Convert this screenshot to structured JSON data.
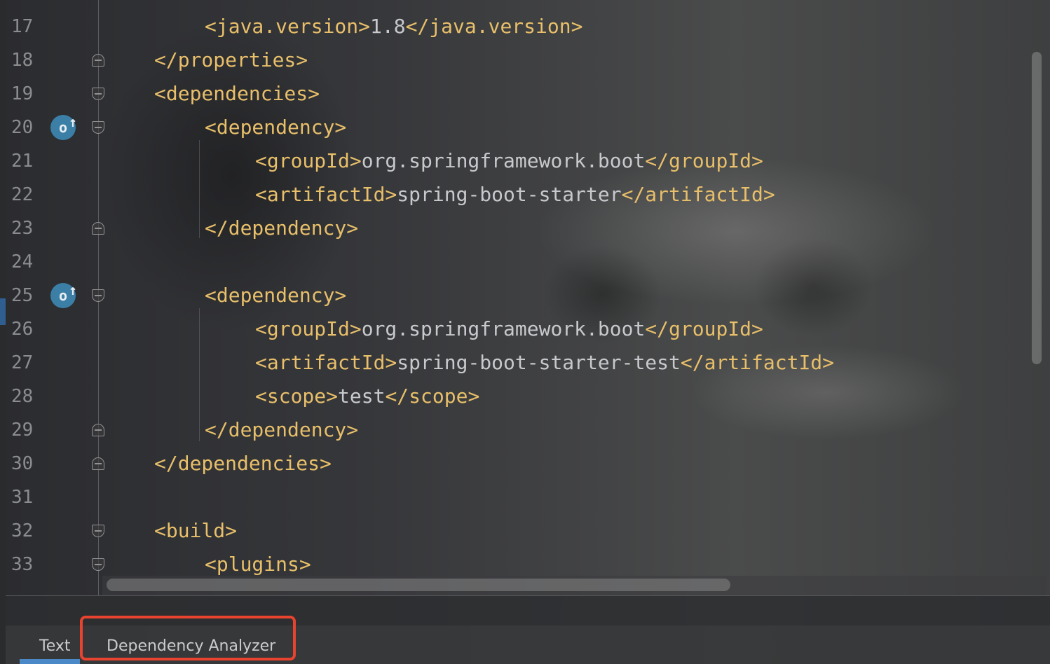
{
  "editor": {
    "lines": [
      {
        "num": "17",
        "indent": 1,
        "parts": [
          {
            "t": "tag",
            "v": "<java.version>"
          },
          {
            "t": "txt",
            "v": "1.8"
          },
          {
            "t": "tag",
            "v": "</java.version>"
          }
        ]
      },
      {
        "num": "18",
        "indent": 0,
        "parts": [
          {
            "t": "tag",
            "v": "</properties>"
          }
        ]
      },
      {
        "num": "19",
        "indent": 0,
        "parts": [
          {
            "t": "tag",
            "v": "<dependencies>"
          }
        ]
      },
      {
        "num": "20",
        "indent": 1,
        "parts": [
          {
            "t": "tag",
            "v": "<dependency>"
          }
        ]
      },
      {
        "num": "21",
        "indent": 2,
        "parts": [
          {
            "t": "tag",
            "v": "<groupId>"
          },
          {
            "t": "txt",
            "v": "org.springframework.boot"
          },
          {
            "t": "tag",
            "v": "</groupId>"
          }
        ]
      },
      {
        "num": "22",
        "indent": 2,
        "parts": [
          {
            "t": "tag",
            "v": "<artifactId>"
          },
          {
            "t": "txt",
            "v": "spring-boot-starter"
          },
          {
            "t": "tag",
            "v": "</artifactId>"
          }
        ]
      },
      {
        "num": "23",
        "indent": 1,
        "parts": [
          {
            "t": "tag",
            "v": "</dependency>"
          }
        ]
      },
      {
        "num": "24",
        "indent": 0,
        "parts": []
      },
      {
        "num": "25",
        "indent": 1,
        "parts": [
          {
            "t": "tag",
            "v": "<dependency>"
          }
        ]
      },
      {
        "num": "26",
        "indent": 2,
        "parts": [
          {
            "t": "tag",
            "v": "<groupId>"
          },
          {
            "t": "txt",
            "v": "org.springframework.boot"
          },
          {
            "t": "tag",
            "v": "</groupId>"
          }
        ]
      },
      {
        "num": "27",
        "indent": 2,
        "parts": [
          {
            "t": "tag",
            "v": "<artifactId>"
          },
          {
            "t": "txt",
            "v": "spring-boot-starter-test"
          },
          {
            "t": "tag",
            "v": "</artifactId>"
          }
        ]
      },
      {
        "num": "28",
        "indent": 2,
        "parts": [
          {
            "t": "tag",
            "v": "<scope>"
          },
          {
            "t": "txt",
            "v": "test"
          },
          {
            "t": "tag",
            "v": "</scope>"
          }
        ]
      },
      {
        "num": "29",
        "indent": 1,
        "parts": [
          {
            "t": "tag",
            "v": "</dependency>"
          }
        ]
      },
      {
        "num": "30",
        "indent": 0,
        "parts": [
          {
            "t": "tag",
            "v": "</dependencies>"
          }
        ]
      },
      {
        "num": "31",
        "indent": 0,
        "parts": []
      },
      {
        "num": "32",
        "indent": 0,
        "parts": [
          {
            "t": "tag",
            "v": "<build>"
          }
        ]
      },
      {
        "num": "33",
        "indent": 1,
        "parts": [
          {
            "t": "tag",
            "v": "<plugins>"
          }
        ]
      }
    ],
    "fold_markers": {
      "18": "close",
      "19": "open",
      "20": "open",
      "23": "close",
      "25": "open",
      "29": "close",
      "30": "close",
      "32": "open",
      "33": "open"
    },
    "maven_icon_lines": [
      "20",
      "25"
    ],
    "colors": {
      "tag": "#e8bf6a",
      "text": "#c7c9cc",
      "line_number": "#8a8c8e",
      "highlight": "#e8432f",
      "active_tab": "#4a88c7"
    }
  },
  "tabs": {
    "text_label": "Text",
    "dependency_analyzer_label": "Dependency Analyzer"
  }
}
